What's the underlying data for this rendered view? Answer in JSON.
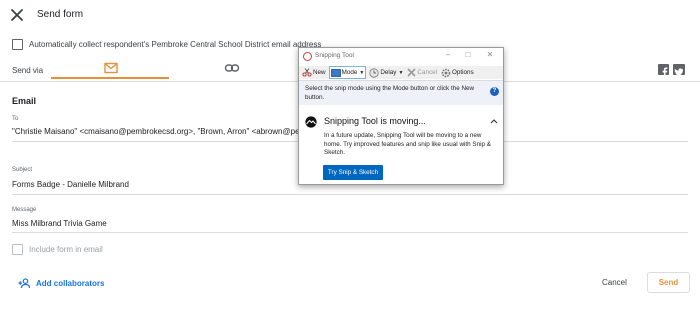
{
  "header": {
    "title": "Send form"
  },
  "collect": {
    "label": "Automatically collect respondent's Pembroke Central School District email address"
  },
  "send_via": {
    "label": "Send via"
  },
  "email": {
    "section_title": "Email",
    "to_label": "To",
    "to_value": "\"Christie Maisano\" <cmaisano@pembrokecsd.org>, \"Brown, Arron\" <abrown@pemb",
    "subject_label": "Subject",
    "subject_value": "Forms Badge - Danielle Milbrand",
    "message_label": "Message",
    "message_value": "Miss Milbrand Trivia Game",
    "include_label": "Include form in email"
  },
  "footer": {
    "collab_label": "Add collaborators",
    "cancel_label": "Cancel",
    "send_label": "Send"
  },
  "snip": {
    "title": "Snipping Tool",
    "toolbar": {
      "new": "New",
      "mode": "Mode",
      "delay": "Delay",
      "cancel": "Cancel",
      "options": "Options"
    },
    "info": "Select the snip mode using the Mode button or click the New button.",
    "moving_title": "Snipping Tool is moving...",
    "moving_body": "In a future update, Snipping Tool will be moving to a new home. Try improved features and snip like usual with Snip & Sketch.",
    "try_button": "Try Snip & Sketch"
  },
  "colors": {
    "accent": "#e69138",
    "link": "#1a73e8",
    "snip_button": "#0067c0"
  }
}
